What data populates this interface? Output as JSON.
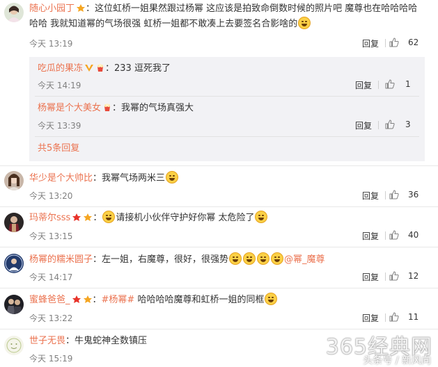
{
  "colors": {
    "username": "#eb7350",
    "meta": "#808080",
    "text": "#333333",
    "subbox": "#f2f2f5"
  },
  "comments": [
    {
      "user": "随心小园丁",
      "text1": "：这位虹桥一姐果然跟过杨幂 这应该是拍致命倒数时候的照片吧 魔尊也在哈哈哈哈",
      "text2": "哈哈 我就知道幂的气场很强 虹桥一姐都不敢凑上去要签名合影啥的",
      "time": "今天 13:19",
      "reply": "回复",
      "likes": "62",
      "subs": [
        {
          "user": "吃瓜的果冻",
          "text": "：233 逗死我了",
          "time": "今天 14:19",
          "reply": "回复",
          "likes": "1"
        },
        {
          "user": "杨幂是个大美女",
          "text": "：我幂的气场真强大",
          "time": "今天 13:39",
          "reply": "回复",
          "likes": "3"
        }
      ],
      "more": "共5条回复"
    },
    {
      "user": "华少是个大帅比",
      "text": "：我幂气场两米三",
      "time": "今天 13:20",
      "reply": "回复",
      "likes": "36"
    },
    {
      "user": "玛蒂尔sss",
      "text": "请接机小伙伴守护好你幂 太危险了",
      "time": "今天 13:15",
      "reply": "回复",
      "likes": "40"
    },
    {
      "user": "杨幂的糯米圆子",
      "text": "：左一姐，右魔尊，很好，很强势",
      "mention": "@幂_魔尊",
      "time": "今天 14:17",
      "reply": "回复",
      "likes": "12"
    },
    {
      "user": "蜜蜂爸爸_",
      "tag": "#杨幂#",
      "text": " 哈哈哈哈魔尊和虹桥一姐的同框",
      "time": "今天 13:22",
      "reply": "回复",
      "likes": "11"
    },
    {
      "user": "世子无畏",
      "text": "：牛鬼蛇神全数镇压",
      "time": "今天 15:19"
    }
  ],
  "watermark": {
    "big": "365经典网",
    "small": "头条号 / 新风向"
  }
}
